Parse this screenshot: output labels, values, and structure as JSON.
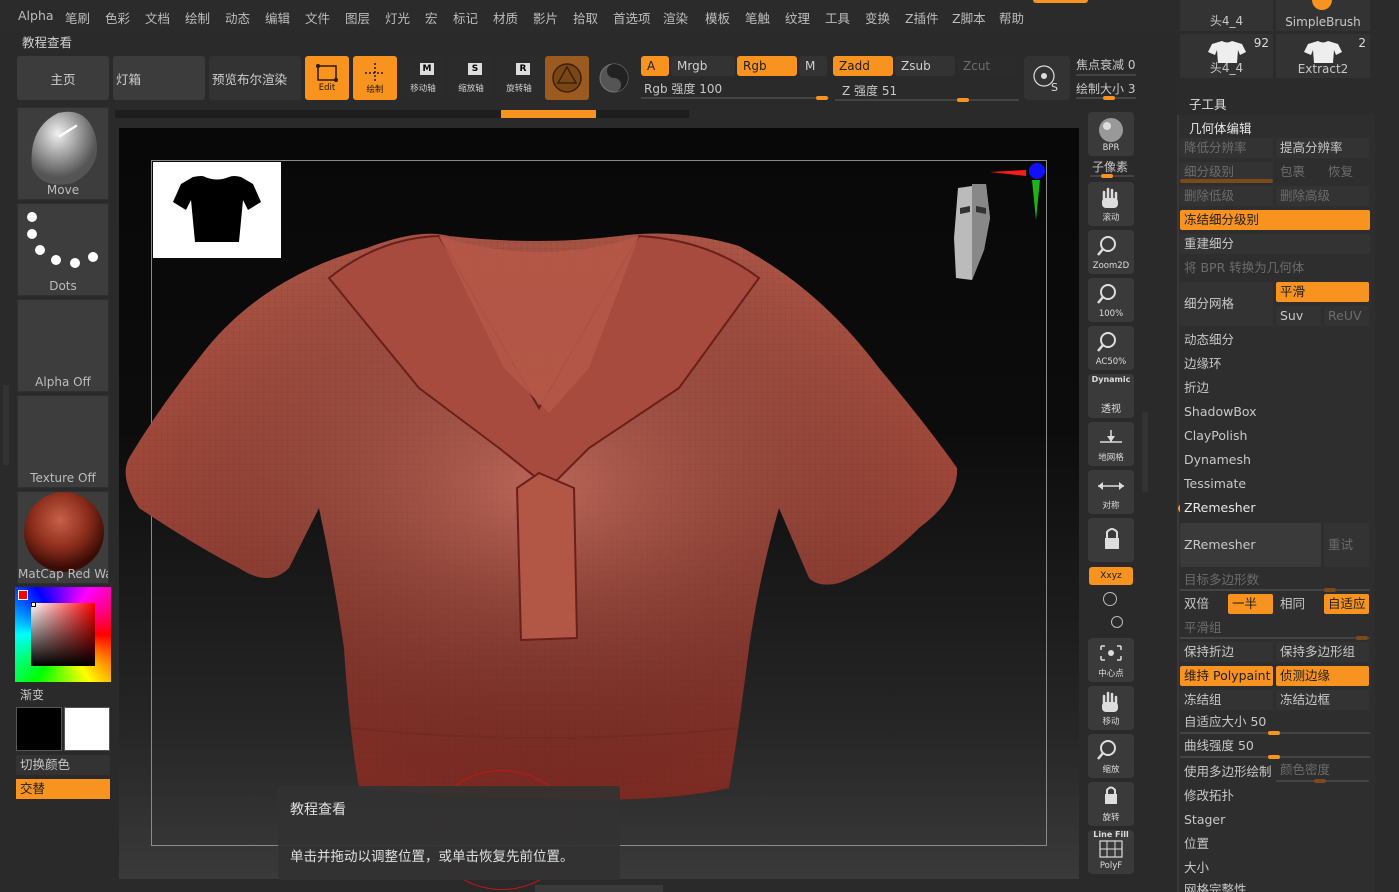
{
  "menu": [
    "Alpha",
    "笔刷",
    "色彩",
    "文档",
    "绘制",
    "动态",
    "编辑",
    "文件",
    "图层",
    "灯光",
    "宏",
    "标记",
    "材质",
    "影片",
    "拾取",
    "首选项",
    "渲染",
    "模板",
    "笔触",
    "纹理",
    "工具",
    "变换",
    "Z插件",
    "Z脚本",
    "帮助"
  ],
  "toolbar": {
    "title": "教程查看",
    "home": "主页",
    "lightbox": "灯箱",
    "preview_bpr": "预览布尔渲染",
    "edit_lbl": "Edit",
    "draw_lbl": "绘制",
    "move_lbl": "移动轴",
    "scale_lbl": "缩放轴",
    "rotate_lbl": "旋转轴",
    "A": "A",
    "mrgb": "Mrgb",
    "rgb": "Rgb",
    "m": "M",
    "zadd": "Zadd",
    "zsub": "Zsub",
    "zcut": "Zcut",
    "rgb_intensity": "Rgb 强度 100",
    "z_intensity": "Z 强度 51",
    "focal_shift": "焦点衰减 0",
    "draw_size": "绘制大小 3",
    "m_letter": "M",
    "s_letter": "S",
    "r_letter": "R"
  },
  "left": {
    "move": "Move",
    "dots": "Dots",
    "alpha_off": "Alpha Off",
    "texture_off": "Texture Off",
    "matcap": "MatCap Red Wax",
    "gradient": "渐变",
    "switch_color": "切换颜色",
    "alternate": "交替"
  },
  "right_toolbar": {
    "bpr": "BPR",
    "subpixel": "子像素",
    "scroll": "滚动",
    "zoom2d": "Zoom2D",
    "pct100": "100%",
    "ac50": "AC50%",
    "dynamic": "Dynamic",
    "persp": "透视",
    "floor": "地网格",
    "sym": "对称",
    "xyz": "Xxyz",
    "center": "中心点",
    "move": "移动",
    "zoom": "缩放",
    "rotate": "旋转",
    "linefill": "Line Fill",
    "polyf": "PolyF"
  },
  "right": {
    "tools": [
      {
        "name": "头4_4",
        "count": ""
      },
      {
        "name": "SimpleBrush",
        "count": ""
      },
      {
        "name": "头4_4",
        "count": "92"
      },
      {
        "name": "Extract2",
        "count": "2"
      }
    ],
    "subtool": "子工具",
    "geometry": "几何体编辑",
    "lower_res": "降低分辨率",
    "higher_res": "提高分辨率",
    "sdiv": "细分级别",
    "cage": "包裹",
    "restore": "恢复",
    "del_lower": "删除低级",
    "del_higher": "删除高级",
    "freeze_sdiv": "冻结细分级别",
    "reconstruct": "重建细分",
    "bpr_to_geo": "将 BPR 转换为几何体",
    "divide": "细分网格",
    "smooth": "平滑",
    "suv": "Suv",
    "reuv": "ReUV",
    "dynamic_sub": "动态细分",
    "edgeloop": "边缘环",
    "crease": "折边",
    "shadowbox": "ShadowBox",
    "claypolish": "ClayPolish",
    "dynamesh": "Dynamesh",
    "tessimate": "Tessimate",
    "zremesher_hdr": "ZRemesher",
    "zremesher_btn": "ZRemesher",
    "retry": "重试",
    "target_poly": "目标多边形数",
    "double": "双倍",
    "half": "一半",
    "same": "相同",
    "adaptive": "自适应",
    "smooth_groups": "平滑组",
    "keep_creases": "保持折边",
    "keep_groups": "保持多边形组",
    "keep_polypaint": "维持 Polypaint",
    "detect_edges": "侦测边缘",
    "freeze_groups": "冻结组",
    "freeze_border": "冻结边框",
    "adaptive_size": "自适应大小 50",
    "curve_strength": "曲线强度 50",
    "use_polypaint": "使用多边形绘制",
    "color_density": "颜色密度",
    "modify_topo": "修改拓扑",
    "stager": "Stager",
    "position": "位置",
    "size": "大小",
    "mesh_integrity": "网格完整性"
  },
  "tooltip": {
    "title": "教程查看",
    "text": "单击并拖动以调整位置，或单击恢复先前位置。"
  }
}
